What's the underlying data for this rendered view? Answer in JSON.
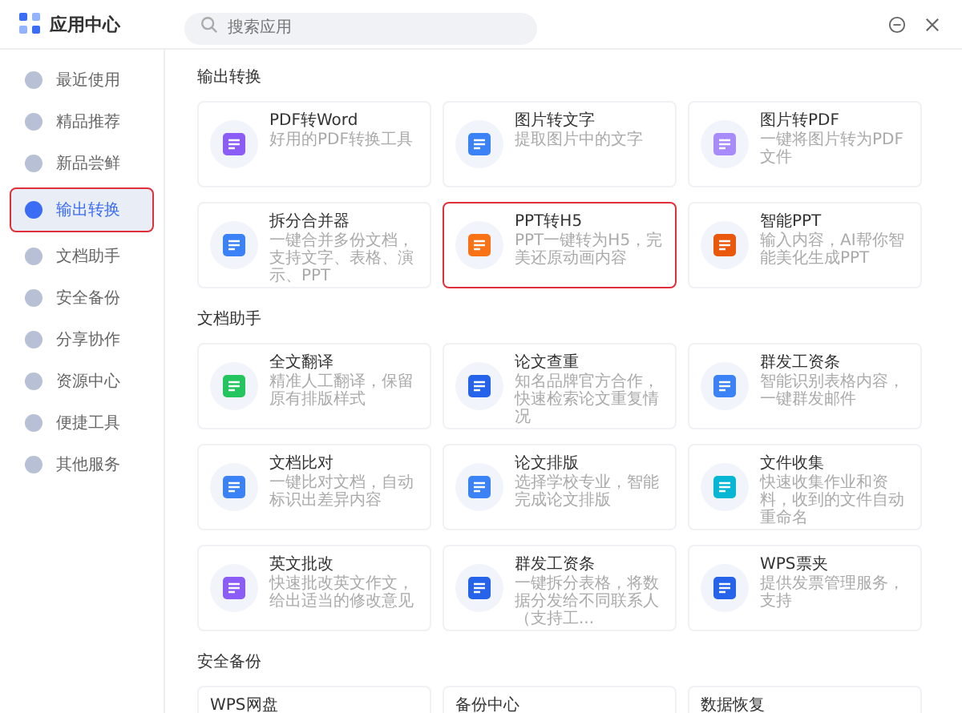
{
  "window": {
    "title": "应用中心"
  },
  "search": {
    "placeholder": "搜索应用"
  },
  "sidebar": {
    "items": [
      {
        "label": "最近使用",
        "selected": false,
        "highlighted": false
      },
      {
        "label": "精品推荐",
        "selected": false,
        "highlighted": false
      },
      {
        "label": "新品尝鲜",
        "selected": false,
        "highlighted": false
      },
      {
        "label": "输出转换",
        "selected": true,
        "highlighted": true
      },
      {
        "label": "文档助手",
        "selected": false,
        "highlighted": false
      },
      {
        "label": "安全备份",
        "selected": false,
        "highlighted": false
      },
      {
        "label": "分享协作",
        "selected": false,
        "highlighted": false
      },
      {
        "label": "资源中心",
        "selected": false,
        "highlighted": false
      },
      {
        "label": "便捷工具",
        "selected": false,
        "highlighted": false
      },
      {
        "label": "其他服务",
        "selected": false,
        "highlighted": false
      }
    ]
  },
  "sections": [
    {
      "title": "输出转换",
      "apps": [
        {
          "name": "PDF转Word",
          "description": "好用的PDF转换工具",
          "color": "#8b5cf6",
          "highlighted": false
        },
        {
          "name": "图片转文字",
          "description": "提取图片中的文字",
          "color": "#3b82f6",
          "highlighted": false
        },
        {
          "name": "图片转PDF",
          "description": "一键将图片转为PDF文件",
          "color": "#a78bfa",
          "highlighted": false
        },
        {
          "name": "拆分合并器",
          "description": "一键合并多份文档，支持文字、表格、演示、PPT",
          "color": "#3b82f6",
          "highlighted": false
        },
        {
          "name": "PPT转H5",
          "description": "PPT一键转为H5，完美还原动画内容",
          "color": "#f97316",
          "highlighted": true
        },
        {
          "name": "智能PPT",
          "description": "输入内容，AI帮你智能美化生成PPT",
          "color": "#ea580c",
          "highlighted": false
        }
      ]
    },
    {
      "title": "文档助手",
      "apps": [
        {
          "name": "全文翻译",
          "description": "精准人工翻译，保留原有排版样式",
          "color": "#22c55e",
          "highlighted": false
        },
        {
          "name": "论文查重",
          "description": "知名品牌官方合作，快速检索论文重复情况",
          "color": "#2563eb",
          "highlighted": false
        },
        {
          "name": "群发工资条",
          "description": "智能识别表格内容，一键群发邮件",
          "color": "#3b82f6",
          "highlighted": false
        },
        {
          "name": "文档比对",
          "description": "一键比对文档，自动标识出差异内容",
          "color": "#3b82f6",
          "highlighted": false
        },
        {
          "name": "论文排版",
          "description": "选择学校专业，智能完成论文排版",
          "color": "#3b82f6",
          "highlighted": false
        },
        {
          "name": "文件收集",
          "description": "快速收集作业和资料，收到的文件自动重命名",
          "color": "#06b6d4",
          "highlighted": false
        },
        {
          "name": "英文批改",
          "description": "快速批改英文作文，给出适当的修改意见",
          "color": "#8b5cf6",
          "highlighted": false
        },
        {
          "name": "群发工资条",
          "description": "一键拆分表格，将数据分发给不同联系人（支持工...",
          "color": "#2563eb",
          "highlighted": false
        },
        {
          "name": "WPS票夹",
          "description": "提供发票管理服务，支持",
          "color": "#2563eb",
          "highlighted": false
        }
      ]
    },
    {
      "title": "安全备份",
      "apps": [
        {
          "name": "WPS网盘",
          "highlighted": false
        },
        {
          "name": "备份中心",
          "highlighted": false
        },
        {
          "name": "数据恢复",
          "highlighted": false
        }
      ]
    }
  ]
}
